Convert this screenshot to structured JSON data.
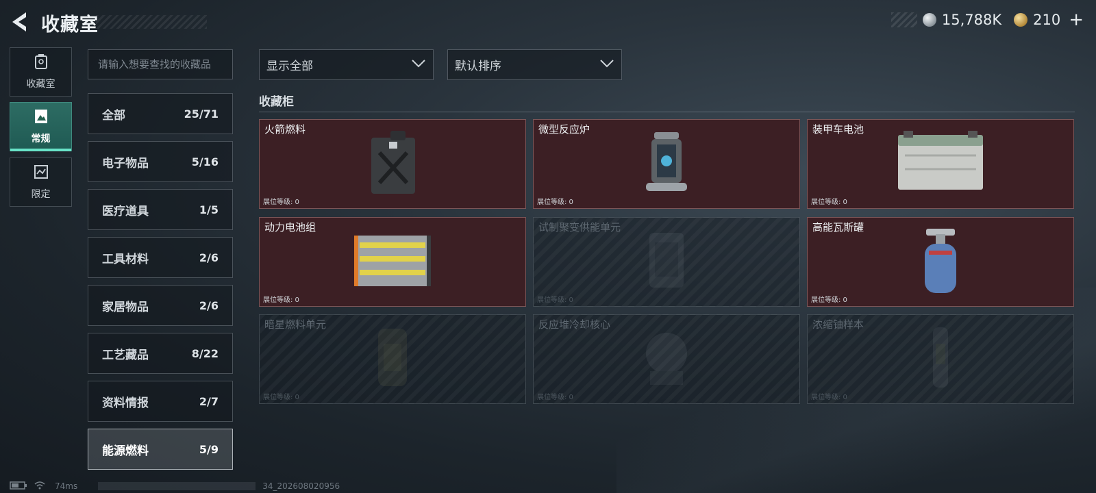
{
  "header": {
    "title": "收藏室",
    "currencies": [
      {
        "icon": "silver-coin-icon",
        "value": "15,788K"
      },
      {
        "icon": "gold-coin-icon",
        "value": "210",
        "plus": "+"
      }
    ]
  },
  "nav": [
    {
      "label": "收藏室",
      "icon": "collection-room-icon",
      "active": false
    },
    {
      "label": "常规",
      "icon": "regular-icon",
      "active": true
    },
    {
      "label": "限定",
      "icon": "limited-icon",
      "active": false
    }
  ],
  "search": {
    "placeholder": "请输入想要查找的收藏品"
  },
  "categories": [
    {
      "label": "全部",
      "count": "25/71"
    },
    {
      "label": "电子物品",
      "count": "5/16"
    },
    {
      "label": "医疗道具",
      "count": "1/5"
    },
    {
      "label": "工具材料",
      "count": "2/6"
    },
    {
      "label": "家居物品",
      "count": "2/6"
    },
    {
      "label": "工艺藏品",
      "count": "8/22"
    },
    {
      "label": "资料情报",
      "count": "2/7"
    },
    {
      "label": "能源燃料",
      "count": "5/9",
      "active": true
    }
  ],
  "filters": {
    "show": "显示全部",
    "sort": "默认排序"
  },
  "section_title": "收藏柜",
  "items": [
    {
      "name": "火箭燃料",
      "level": "展位等级: 0",
      "owned": true,
      "icon": "fuel-canister-icon"
    },
    {
      "name": "微型反应炉",
      "level": "展位等级: 0",
      "owned": true,
      "icon": "mini-reactor-icon"
    },
    {
      "name": "装甲车电池",
      "level": "展位等级: 0",
      "owned": true,
      "icon": "vehicle-battery-icon"
    },
    {
      "name": "动力电池组",
      "level": "展位等级: 0",
      "owned": true,
      "icon": "battery-pack-icon"
    },
    {
      "name": "试制聚变供能单元",
      "level": "展位等级: 0",
      "owned": false,
      "icon": "fusion-unit-icon"
    },
    {
      "name": "高能瓦斯罐",
      "level": "展位等级: 0",
      "owned": true,
      "icon": "gas-tank-icon"
    },
    {
      "name": "暗星燃料单元",
      "level": "展位等级: 0",
      "owned": false,
      "icon": "darkstar-fuel-icon"
    },
    {
      "name": "反应堆冷却核心",
      "level": "展位等级: 0",
      "owned": false,
      "icon": "reactor-core-icon"
    },
    {
      "name": "浓缩铀样本",
      "level": "展位等级: 0",
      "owned": false,
      "icon": "uranium-sample-icon"
    }
  ],
  "status": {
    "ping": "74ms",
    "build": "34_202608020956"
  }
}
